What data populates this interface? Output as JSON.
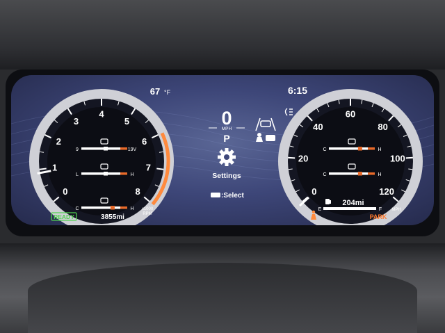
{
  "status_bar": {
    "temperature": "67",
    "temperature_unit": "°F",
    "clock": "6:15"
  },
  "center": {
    "speed_value": "0",
    "speed_unit": "MPH",
    "gear": "P",
    "settings_label": "Settings",
    "select_label": ":Select"
  },
  "tachometer": {
    "scale_labels": [
      "0",
      "1",
      "2",
      "3",
      "4",
      "5",
      "6",
      "7",
      "8"
    ],
    "unit_line1": "x1000",
    "unit_line2": "RPM",
    "needle_value": 0.9,
    "gauges": [
      {
        "icon": "battery-icon",
        "min_label": "9",
        "max_label": "19V",
        "level": 0.5
      },
      {
        "icon": "oil-pressure-icon",
        "min_label": "L",
        "max_label": "H",
        "level": 0.5
      },
      {
        "icon": "coolant-temperature-icon",
        "min_label": "C",
        "max_label": "H",
        "level": 0.65
      }
    ],
    "ready_label": "READY",
    "odometer": "3855mi"
  },
  "speedometer": {
    "scale_labels": [
      "0",
      "20",
      "40",
      "60",
      "80",
      "100",
      "120"
    ],
    "unit": "MPH",
    "gauges": [
      {
        "icon": "oil-temperature-icon",
        "min_label": "C",
        "max_label": "H",
        "level": 0.65
      },
      {
        "icon": "transmission-temperature-icon",
        "min_label": "C",
        "max_label": "H",
        "level": 0.65
      }
    ],
    "fuel": {
      "empty_label": "E",
      "full_label": "F",
      "range": "204mi",
      "level": 1.0
    },
    "park_label": "PARK"
  },
  "colors": {
    "accent_orange": "#ff8a3d",
    "ready_green": "#4fd14f",
    "park_orange": "#ff7a2e",
    "redline": "#e86a2a"
  }
}
